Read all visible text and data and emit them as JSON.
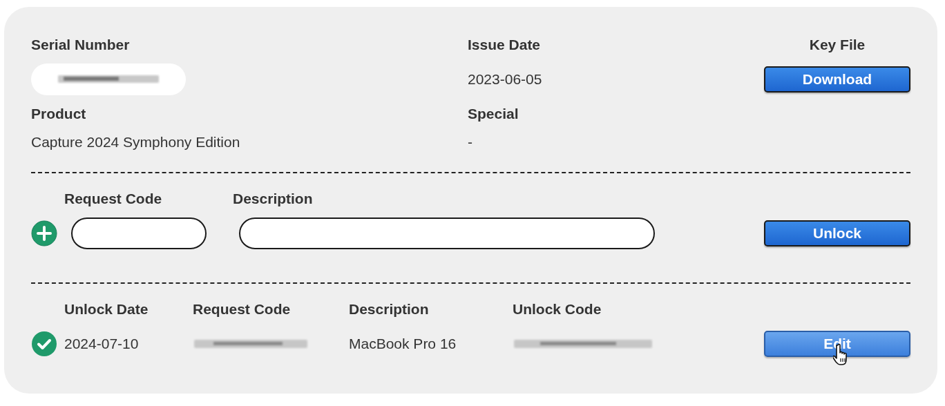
{
  "details": {
    "serial_number": {
      "label": "Serial Number"
    },
    "issue_date": {
      "label": "Issue Date",
      "value": "2023-06-05"
    },
    "key_file": {
      "label": "Key File",
      "button": "Download"
    },
    "product": {
      "label": "Product",
      "value": "Capture 2024 Symphony Edition"
    },
    "special": {
      "label": "Special",
      "value": "-"
    }
  },
  "request_form": {
    "request_code_label": "Request Code",
    "description_label": "Description",
    "button": "Unlock"
  },
  "unlocks": {
    "columns": [
      "Unlock Date",
      "Request Code",
      "Description",
      "Unlock Code"
    ],
    "rows": [
      {
        "unlocked": true,
        "unlock_date": "2024-07-10",
        "description": "MacBook Pro 16",
        "button": "Edit",
        "hovered": true
      }
    ]
  }
}
